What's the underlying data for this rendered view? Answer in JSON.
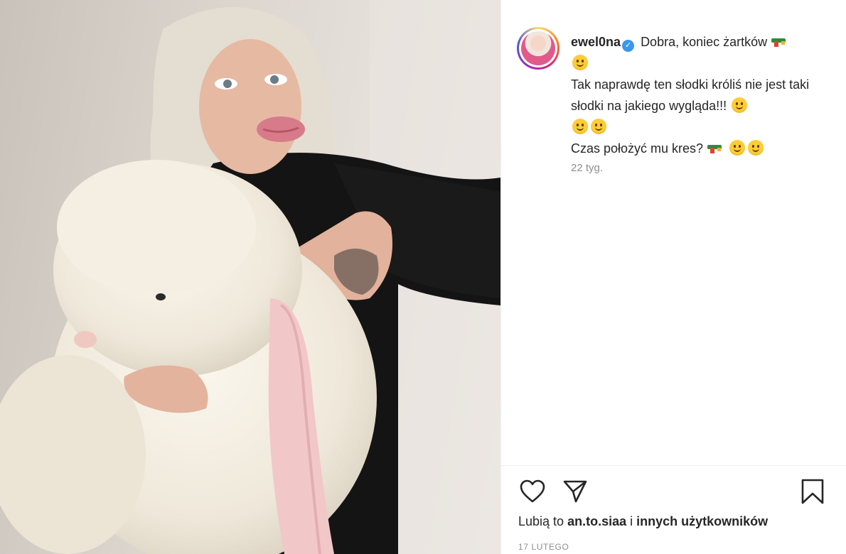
{
  "post": {
    "username": "ewel0na",
    "caption_line1": "Dobra, koniec żartków",
    "caption_line2": "Tak naprawdę ten słodki króliś nie jest taki słodki na jakiego wygląda!!!",
    "caption_line3": "Czas położyć mu kres?",
    "time_ago": "22 tyg.",
    "likes_prefix": "Lubią to",
    "likes_user": "an.to.siaa",
    "likes_connector": "i",
    "likes_others": "innych użytkowników",
    "date": "17 LUTEGO"
  },
  "icons": {
    "verified": "verified-badge-icon",
    "like": "heart-icon",
    "share": "paper-plane-icon",
    "save": "bookmark-icon",
    "water_gun": "water-pistol-emoji",
    "smirk": "smirk-emoji"
  },
  "colors": {
    "verified": "#3897f0",
    "text": "#262626",
    "muted": "#8e8e8e"
  }
}
